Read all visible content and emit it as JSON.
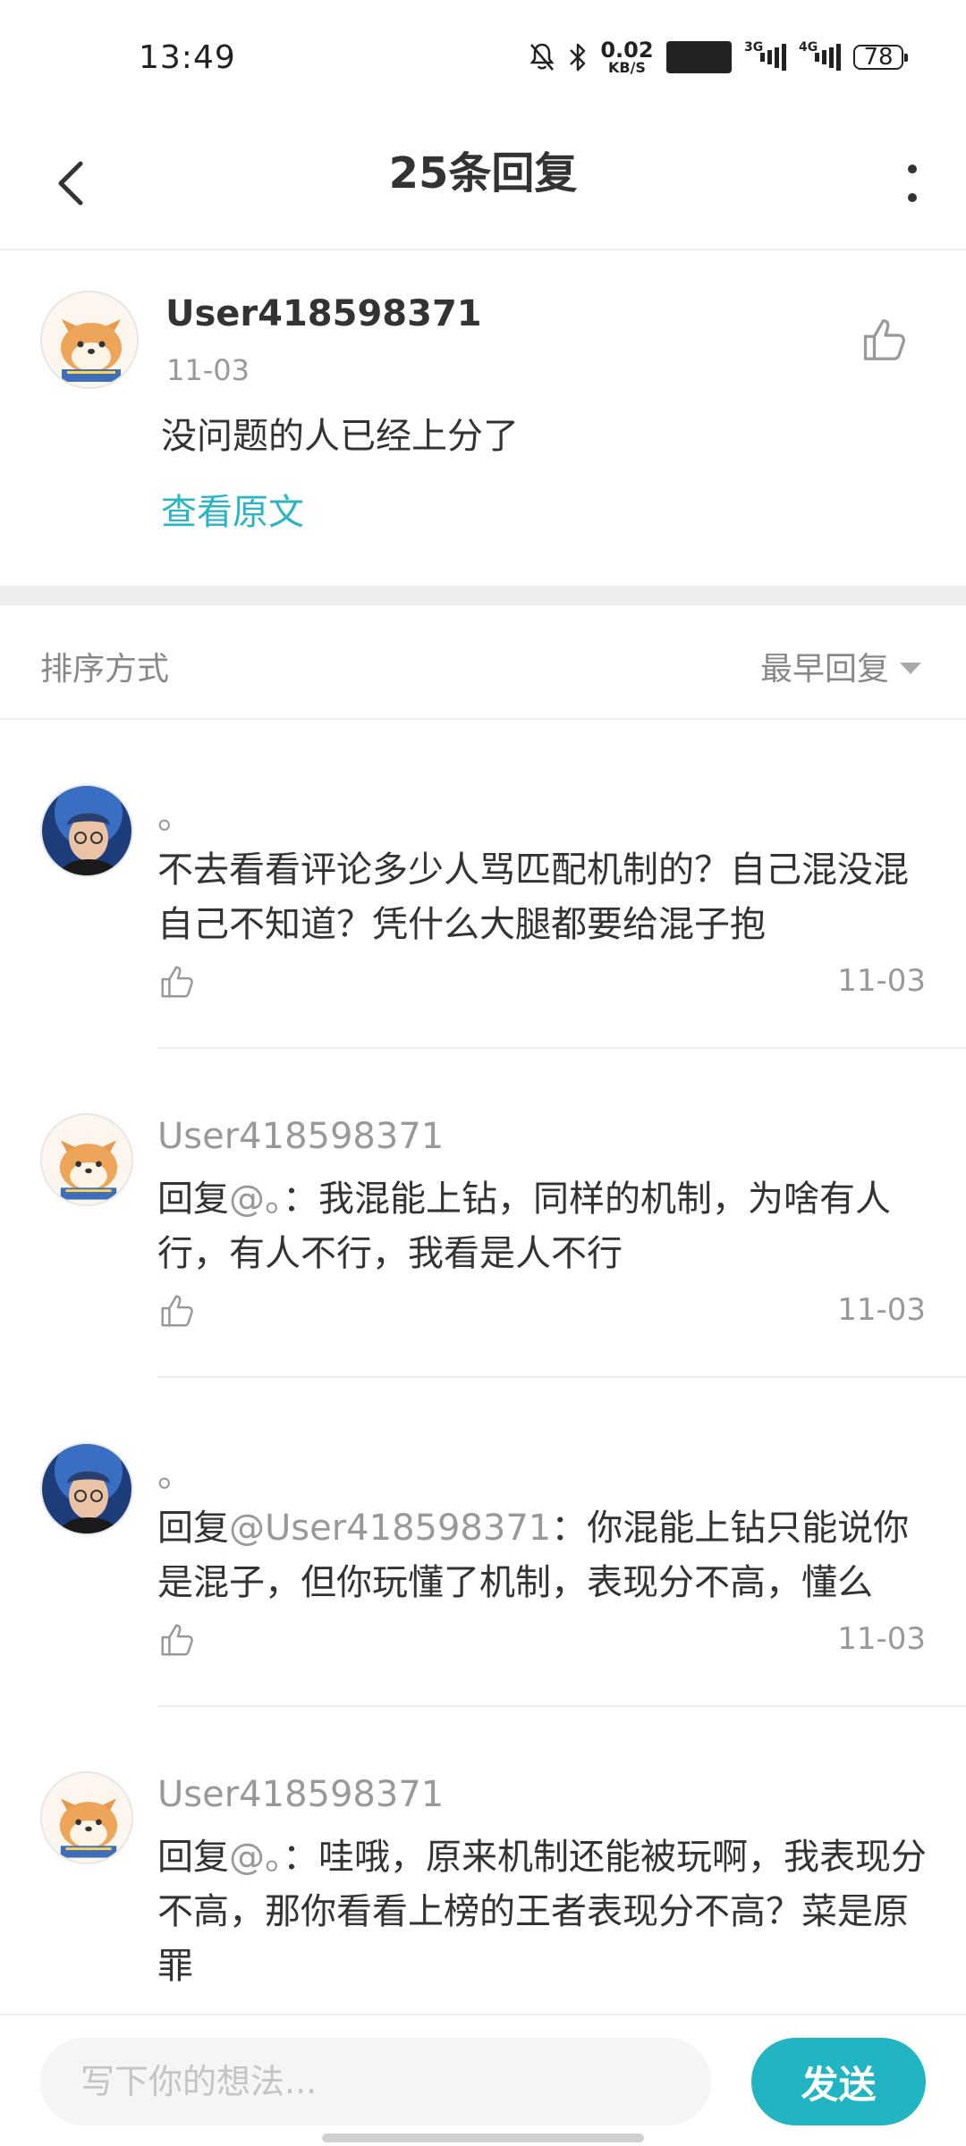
{
  "status_bar": {
    "time": "13:49",
    "net_speed_value": "0.02",
    "net_speed_unit": "KB/S",
    "hd_badge": "HD2",
    "signal1_label": "3G",
    "signal2_label": "4G",
    "battery": "78"
  },
  "header": {
    "title": "25条回复"
  },
  "original_comment": {
    "username": "User418598371",
    "date": "11-03",
    "text": "没问题的人已经上分了",
    "view_original": "查看原文"
  },
  "sort": {
    "label": "排序方式",
    "selected": "最早回复"
  },
  "replies": [
    {
      "username": "。",
      "prefix": "",
      "mention": "",
      "text": "不去看看评论多少人骂匹配机制的？自己混没混自己不知道？凭什么大腿都要给混子抱",
      "date": "11-03",
      "avatar": "person-avatar"
    },
    {
      "username": "User418598371",
      "prefix": "回复",
      "mention": "@。",
      "text": "：我混能上钻，同样的机制，为啥有人行，有人不行，我看是人不行",
      "date": "11-03",
      "avatar": "shiba-avatar"
    },
    {
      "username": "。",
      "prefix": "回复",
      "mention": "@User418598371",
      "text": "：你混能上钻只能说你是混子，但你玩懂了机制，表现分不高，懂么",
      "date": "11-03",
      "avatar": "person-avatar"
    },
    {
      "username": "User418598371",
      "prefix": "回复",
      "mention": "@。",
      "text": "：哇哦，原来机制还能被玩啊，我表现分不高，那你看看上榜的王者表现分不高？菜是原罪",
      "date": "",
      "avatar": "shiba-avatar"
    }
  ],
  "composer": {
    "placeholder": "写下你的想法...",
    "send_label": "发送"
  },
  "colors": {
    "accent": "#21b5c3",
    "link": "#2bb5c2",
    "muted": "#999999"
  }
}
